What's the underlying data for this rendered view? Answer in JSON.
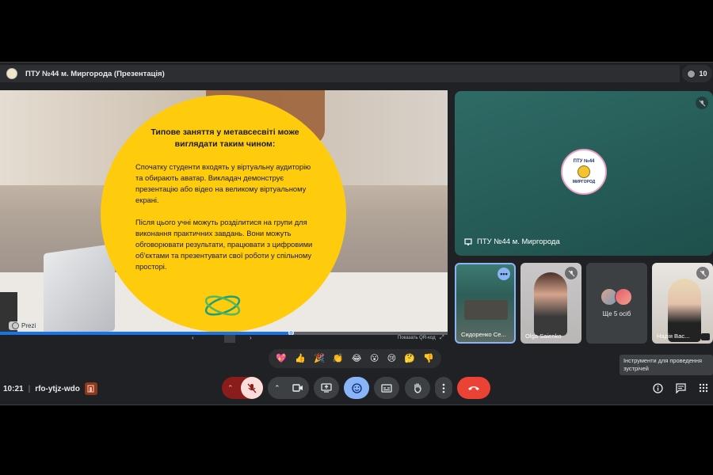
{
  "meeting": {
    "title": "ПТУ №44 м. Миргорода (Презентація)",
    "participants_count": "10",
    "time": "10:21",
    "separator": "|",
    "code": "rfo-ytjz-wdo"
  },
  "slide": {
    "heading": "Типове заняття у метавсесвіті може виглядати таким чином:",
    "paragraph1": "Спочатку студенти входять у віртуальну аудиторію та обирають аватар. Викладач демонструє презентацію або відео на великому віртуальному екрані.",
    "paragraph2": "Після цього учні можуть розділитися на групи для виконання практичних завдань. Вони можуть обговорювати результати, працювати з цифровими об'єктами та презентувати свої роботи у спільному просторі.",
    "watermark": "Prezi",
    "progress": 0.65,
    "prev_label": "‹",
    "next_label": "›",
    "qr_label": "Показать QR-код"
  },
  "tiles": {
    "main": {
      "name": "ПТУ №44 м. Миргорода",
      "logo_top": "ПТУ №44",
      "logo_bottom": "МИРГОРОД"
    },
    "t1": {
      "name": "Сидоренко Се..."
    },
    "t2": {
      "name": "Olga Saienko"
    },
    "t3": {
      "label": "Ще 5 осіб"
    },
    "t4": {
      "name": "Надія Вас..."
    }
  },
  "reactions": [
    "💖",
    "👍",
    "🎉",
    "👏",
    "😂",
    "😮",
    "😢",
    "🤔",
    "👎"
  ],
  "tooltip": "Інструменти для проведення зустрічей",
  "colors": {
    "accent": "#8ab4f8",
    "end_call": "#ea4335",
    "slide_circle": "#ffcc0d",
    "mic_off_bg": "#8b1c1c"
  }
}
